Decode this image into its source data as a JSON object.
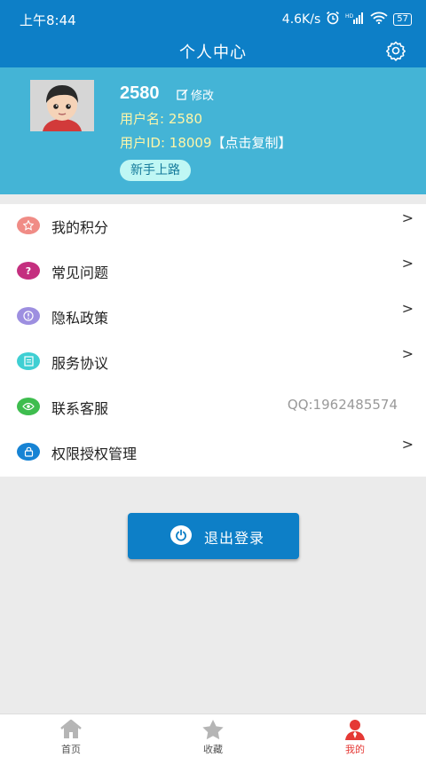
{
  "status_bar": {
    "time": "上午8:44",
    "net_speed": "4.6K/s",
    "signal": "HD",
    "battery": "57"
  },
  "header": {
    "title": "个人中心",
    "settings_icon": "gear-icon"
  },
  "profile": {
    "name": "2580",
    "edit_label": "修改",
    "username_line": "用户名: 2580",
    "userid_line": "用户ID: 18009",
    "copy_label": "【点击复制】",
    "guide_label": "新手上路"
  },
  "menu": {
    "items": [
      {
        "label": "我的积分",
        "icon": "star-icon",
        "color": "#f08c86"
      },
      {
        "label": "常见问题",
        "icon": "question-icon",
        "color": "#c42f7f"
      },
      {
        "label": "隐私政策",
        "icon": "info-icon",
        "color": "#9d8fe0"
      },
      {
        "label": "服务协议",
        "icon": "document-icon",
        "color": "#3fcfd3"
      },
      {
        "label": "联系客服",
        "icon": "eye-icon",
        "color": "#3ebd4e",
        "value": "QQ:1962485574"
      },
      {
        "label": "权限授权管理",
        "icon": "lock-icon",
        "color": "#1683d4"
      }
    ]
  },
  "logout": {
    "label": "退出登录"
  },
  "tabbar": {
    "tabs": [
      {
        "label": "首页",
        "icon": "home-icon"
      },
      {
        "label": "收藏",
        "icon": "star-icon"
      },
      {
        "label": "我的",
        "icon": "person-icon"
      }
    ],
    "active": 2
  },
  "colors": {
    "primary": "#0d7fc7",
    "profile_bg": "#44b4d6",
    "highlight_text": "#fff6a8",
    "active_tab": "#e53935"
  }
}
